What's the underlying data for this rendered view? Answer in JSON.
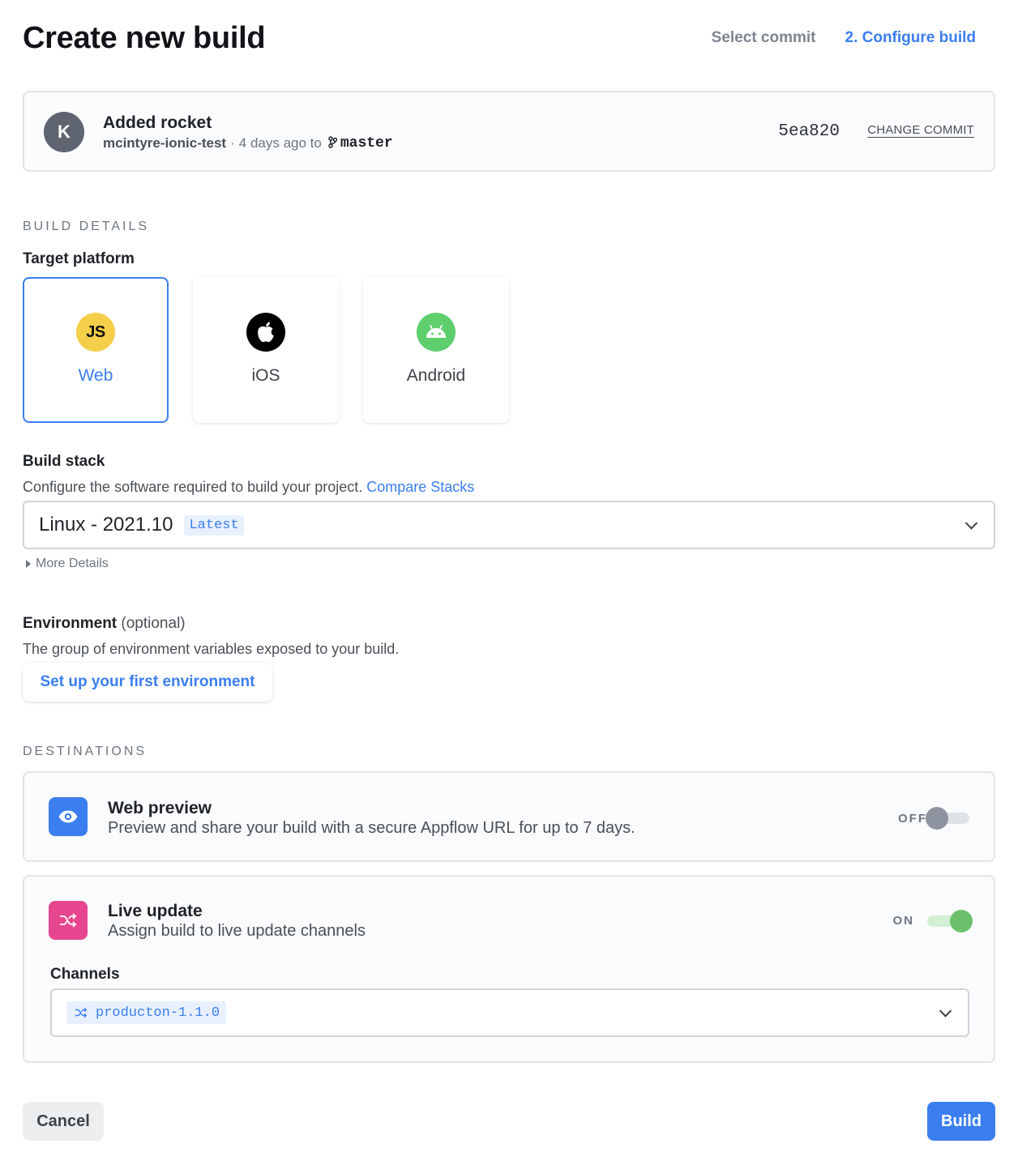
{
  "header": {
    "title": "Create new build",
    "steps": [
      {
        "label": "Select commit"
      },
      {
        "label": "2. Configure build"
      }
    ]
  },
  "commit": {
    "avatar_initial": "K",
    "title": "Added rocket",
    "repo": "mcintyre-ionic-test",
    "separator": "·",
    "time_text": "4 days ago to",
    "branch_icon": "git-branch-icon",
    "branch": "master",
    "sha": "5ea820",
    "change_label": "CHANGE COMMIT"
  },
  "build_details": {
    "section_label": "BUILD DETAILS",
    "target_platform_label": "Target platform",
    "platforms": [
      {
        "name": "Web",
        "icon": "javascript-icon",
        "icon_text": "JS",
        "color": "#f5cf4a",
        "selected": true
      },
      {
        "name": "iOS",
        "icon": "apple-icon",
        "color": "#000000",
        "selected": false
      },
      {
        "name": "Android",
        "icon": "android-icon",
        "color": "#5fce6d",
        "selected": false
      }
    ],
    "build_stack_label": "Build stack",
    "build_stack_help": "Configure the software required to build your project.",
    "compare_stacks_link": "Compare Stacks",
    "stack_value": "Linux - 2021.10",
    "stack_badge": "Latest",
    "more_details": "More Details"
  },
  "environment": {
    "label": "Environment",
    "optional": "(optional)",
    "help": "The group of environment variables exposed to your build.",
    "button": "Set up your first environment"
  },
  "destinations": {
    "section_label": "DESTINATIONS",
    "web_preview": {
      "title": "Web preview",
      "description": "Preview and share your build with a secure Appflow URL for up to 7 days.",
      "toggle_label": "OFF",
      "enabled": false,
      "icon": "eye-icon",
      "icon_color": "#3b7ef0"
    },
    "live_update": {
      "title": "Live update",
      "description": "Assign build to live update channels",
      "toggle_label": "ON",
      "enabled": true,
      "icon": "shuffle-icon",
      "icon_color": "#e5468f",
      "channels_label": "Channels",
      "channels": [
        "producton-1.1.0"
      ]
    }
  },
  "footer": {
    "cancel": "Cancel",
    "build": "Build"
  },
  "colors": {
    "accent": "#3b7ef0",
    "toggle_on": "#6cc06c",
    "toggle_off": "#8d94a0"
  }
}
